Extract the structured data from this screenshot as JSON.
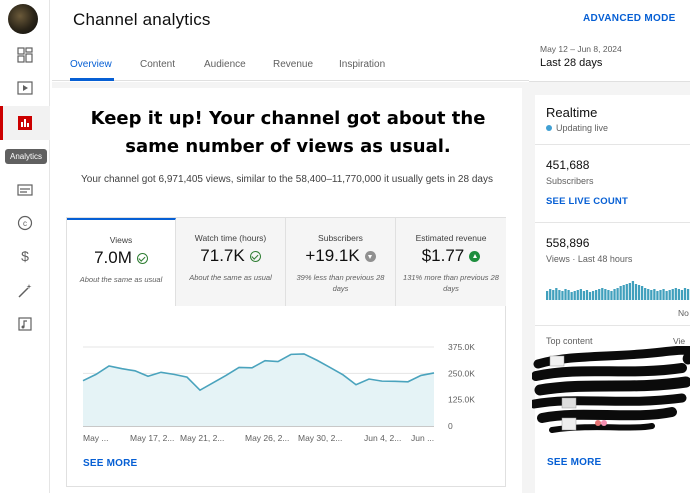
{
  "app": {
    "title": "Channel analytics",
    "advanced_mode": "ADVANCED MODE"
  },
  "sidebar": {
    "items": [
      {
        "icon": "dashboard-icon"
      },
      {
        "icon": "content-icon"
      },
      {
        "icon": "analytics-icon",
        "active": true
      },
      {
        "icon": "subtitles-icon"
      },
      {
        "icon": "copyright-icon"
      },
      {
        "icon": "earn-icon"
      },
      {
        "icon": "customization-icon"
      },
      {
        "icon": "audio-library-icon"
      }
    ],
    "tooltip": "Analytics"
  },
  "tabs": [
    {
      "label": "Overview",
      "active": true
    },
    {
      "label": "Content"
    },
    {
      "label": "Audience"
    },
    {
      "label": "Revenue"
    },
    {
      "label": "Inspiration"
    }
  ],
  "date": {
    "range": "May 12 – Jun 8, 2024",
    "period": "Last 28 days"
  },
  "summary": {
    "headline": "Keep it up! Your channel got about the same number of views as usual.",
    "sub": "Your channel got 6,971,405 views, similar to the 58,400–11,770,000 it usually gets in 28 days"
  },
  "metrics": [
    {
      "label": "Views",
      "value": "7.0M",
      "status": "check",
      "note": "About the same as usual"
    },
    {
      "label": "Watch time (hours)",
      "value": "71.7K",
      "status": "check",
      "note": "About the same as usual"
    },
    {
      "label": "Subscribers",
      "value": "+19.1K",
      "status": "down",
      "note": "39% less than previous 28 days"
    },
    {
      "label": "Estimated revenue",
      "value": "$1.77",
      "status": "up",
      "note": "131% more than previous 28 days"
    }
  ],
  "chart_data": {
    "type": "area",
    "x": [
      "May 12",
      "May 13",
      "May 14",
      "May 15",
      "May 16",
      "May 17",
      "May 18",
      "May 19",
      "May 20",
      "May 21",
      "May 22",
      "May 23",
      "May 24",
      "May 25",
      "May 26",
      "May 27",
      "May 28",
      "May 29",
      "May 30",
      "May 31",
      "Jun 1",
      "Jun 2",
      "Jun 3",
      "Jun 4",
      "Jun 5",
      "Jun 6",
      "Jun 7",
      "Jun 8"
    ],
    "values": [
      215000,
      245000,
      285000,
      272000,
      262000,
      236000,
      255000,
      245000,
      232000,
      170000,
      205000,
      240000,
      278000,
      276000,
      310000,
      306000,
      340000,
      342000,
      312000,
      278000,
      243000,
      196000,
      223000,
      213000,
      212000,
      210000,
      240000,
      252000
    ],
    "xticks": [
      "May ...",
      "May 17, 2...",
      "May 21, 2...",
      "May 26, 2...",
      "May 30, 2...",
      "Jun 4, 2...",
      "Jun ..."
    ],
    "yticks": [
      "375.0K",
      "250.0K",
      "125.0K",
      "0"
    ],
    "ylim": [
      0,
      375000
    ],
    "colors": {
      "line": "#4aa3bd",
      "fill": "#e5f3f6"
    }
  },
  "see_more": "SEE MORE",
  "realtime": {
    "title": "Realtime",
    "live": "Updating live",
    "subscribers_value": "451,688",
    "subscribers_label": "Subscribers",
    "see_live_count": "SEE LIVE COUNT",
    "views_value": "558,896",
    "views_label": "Views · Last 48 hours",
    "bars": [
      0.45,
      0.55,
      0.5,
      0.6,
      0.5,
      0.45,
      0.55,
      0.5,
      0.4,
      0.45,
      0.5,
      0.55,
      0.45,
      0.5,
      0.4,
      0.45,
      0.5,
      0.55,
      0.6,
      0.55,
      0.5,
      0.45,
      0.55,
      0.6,
      0.7,
      0.75,
      0.8,
      0.85,
      0.95,
      0.8,
      0.75,
      0.7,
      0.6,
      0.55,
      0.5,
      0.55,
      0.45,
      0.5,
      0.55,
      0.45,
      0.5,
      0.55,
      0.6,
      0.55,
      0.5,
      0.6,
      0.55
    ],
    "cut_text": "No",
    "top_content": "Top content",
    "top_content_more": "Vie",
    "see_more": "SEE MORE"
  }
}
